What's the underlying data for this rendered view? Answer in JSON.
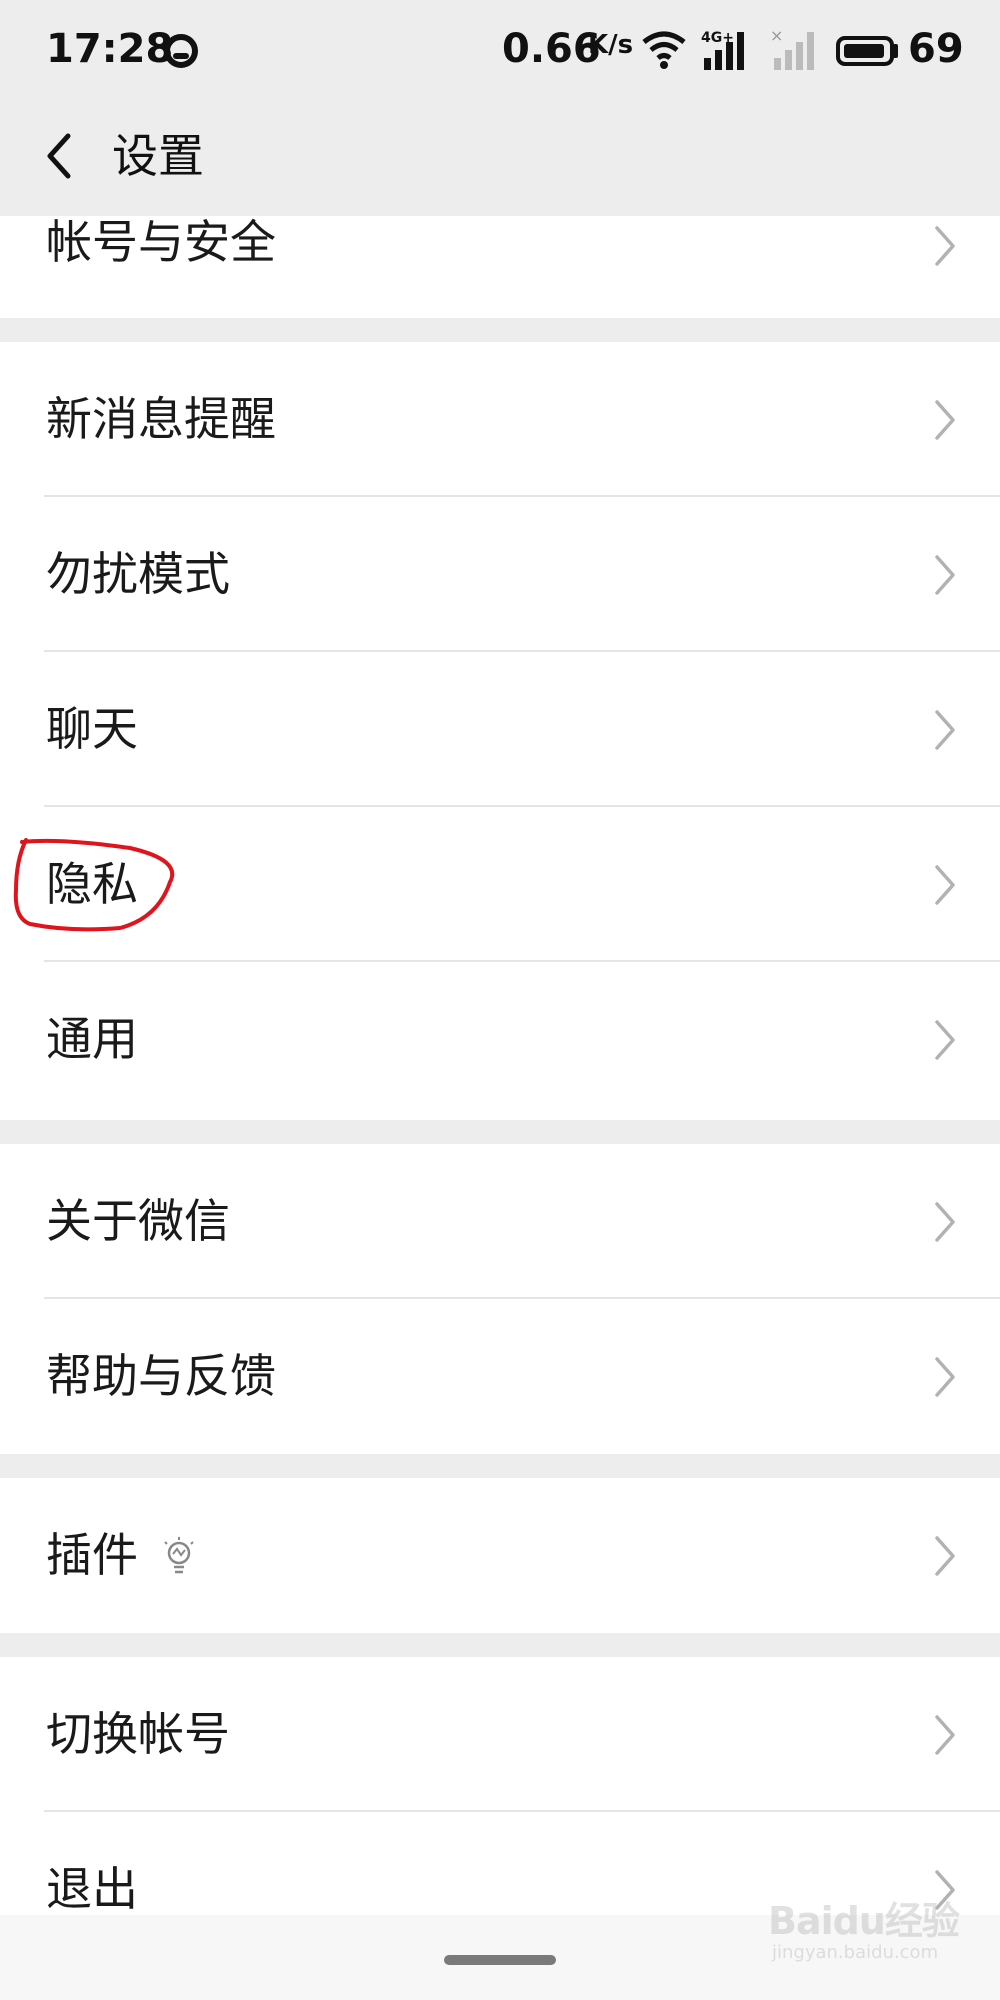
{
  "status_bar": {
    "time": "17:28",
    "net_speed": "0.66",
    "net_speed_unit": "K/s",
    "network_label": "4G+",
    "battery": "69"
  },
  "nav": {
    "title": "设置"
  },
  "groups": [
    {
      "items": [
        {
          "label": "帐号与安全"
        }
      ]
    },
    {
      "items": [
        {
          "label": "新消息提醒"
        },
        {
          "label": "勿扰模式"
        },
        {
          "label": "聊天"
        },
        {
          "label": "隐私"
        },
        {
          "label": "通用"
        }
      ]
    },
    {
      "items": [
        {
          "label": "关于微信"
        },
        {
          "label": "帮助与反馈"
        }
      ]
    },
    {
      "items": [
        {
          "label": "插件"
        }
      ]
    },
    {
      "items": [
        {
          "label": "切换帐号"
        },
        {
          "label": "退出"
        }
      ]
    }
  ],
  "watermark": {
    "brand": "Baidu经验",
    "url": "jingyan.baidu.com"
  },
  "colors": {
    "background": "#ededed",
    "item_background": "#ffffff",
    "annotation": "#e0141c"
  }
}
